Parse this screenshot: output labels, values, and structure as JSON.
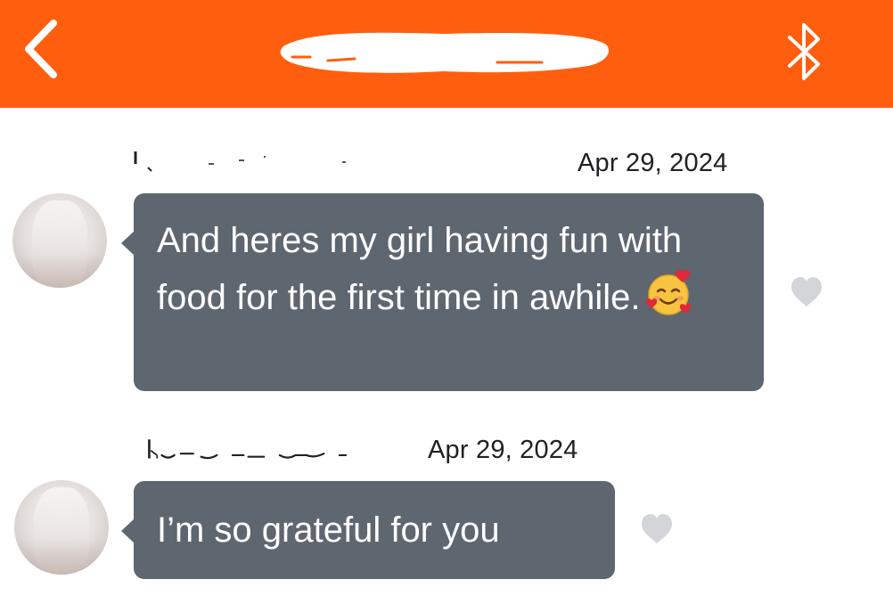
{
  "header": {
    "background_color": "#ff5e0e",
    "back_icon": "chevron-left",
    "right_icon": "bluetooth"
  },
  "messages": [
    {
      "date": "Apr 29, 2024",
      "text": "And heres my girl having fun with food for the first time in awhile.",
      "emoji": "smiling-face-with-hearts",
      "liked": false
    },
    {
      "date": "Apr 29, 2024",
      "text": "I’m so grateful for you",
      "liked": false
    }
  ],
  "colors": {
    "bubble": "#5e6670",
    "like_heart": "#d3d5d8"
  }
}
